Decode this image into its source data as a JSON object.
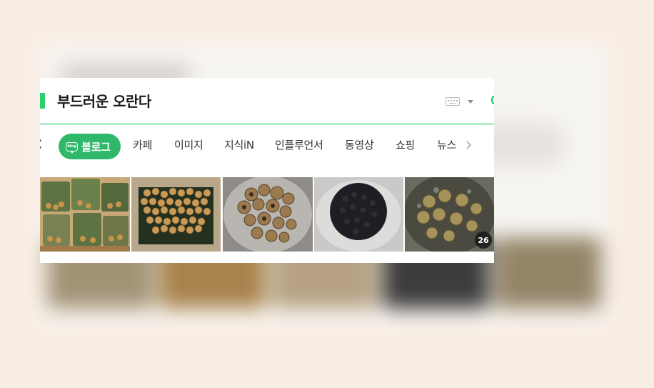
{
  "search": {
    "query": "부드러운 오란다"
  },
  "tabs": {
    "items": [
      {
        "label": "블로그",
        "active": true
      },
      {
        "label": "카페"
      },
      {
        "label": "이미지"
      },
      {
        "label": "지식iN"
      },
      {
        "label": "인플루언서"
      },
      {
        "label": "동영상"
      },
      {
        "label": "쇼핑"
      },
      {
        "label": "뉴스"
      }
    ],
    "blog_icon_text": "blog"
  },
  "thumbnails": {
    "count_badge": "26"
  },
  "colors": {
    "accent": "#03c75a",
    "active_tab": "#2fb86a",
    "page_background": "#f8ede3"
  },
  "icons": [
    "keyboard-icon",
    "dropdown-caret-icon",
    "chevron-left-icon",
    "chevron-right-icon",
    "blog-icon"
  ]
}
